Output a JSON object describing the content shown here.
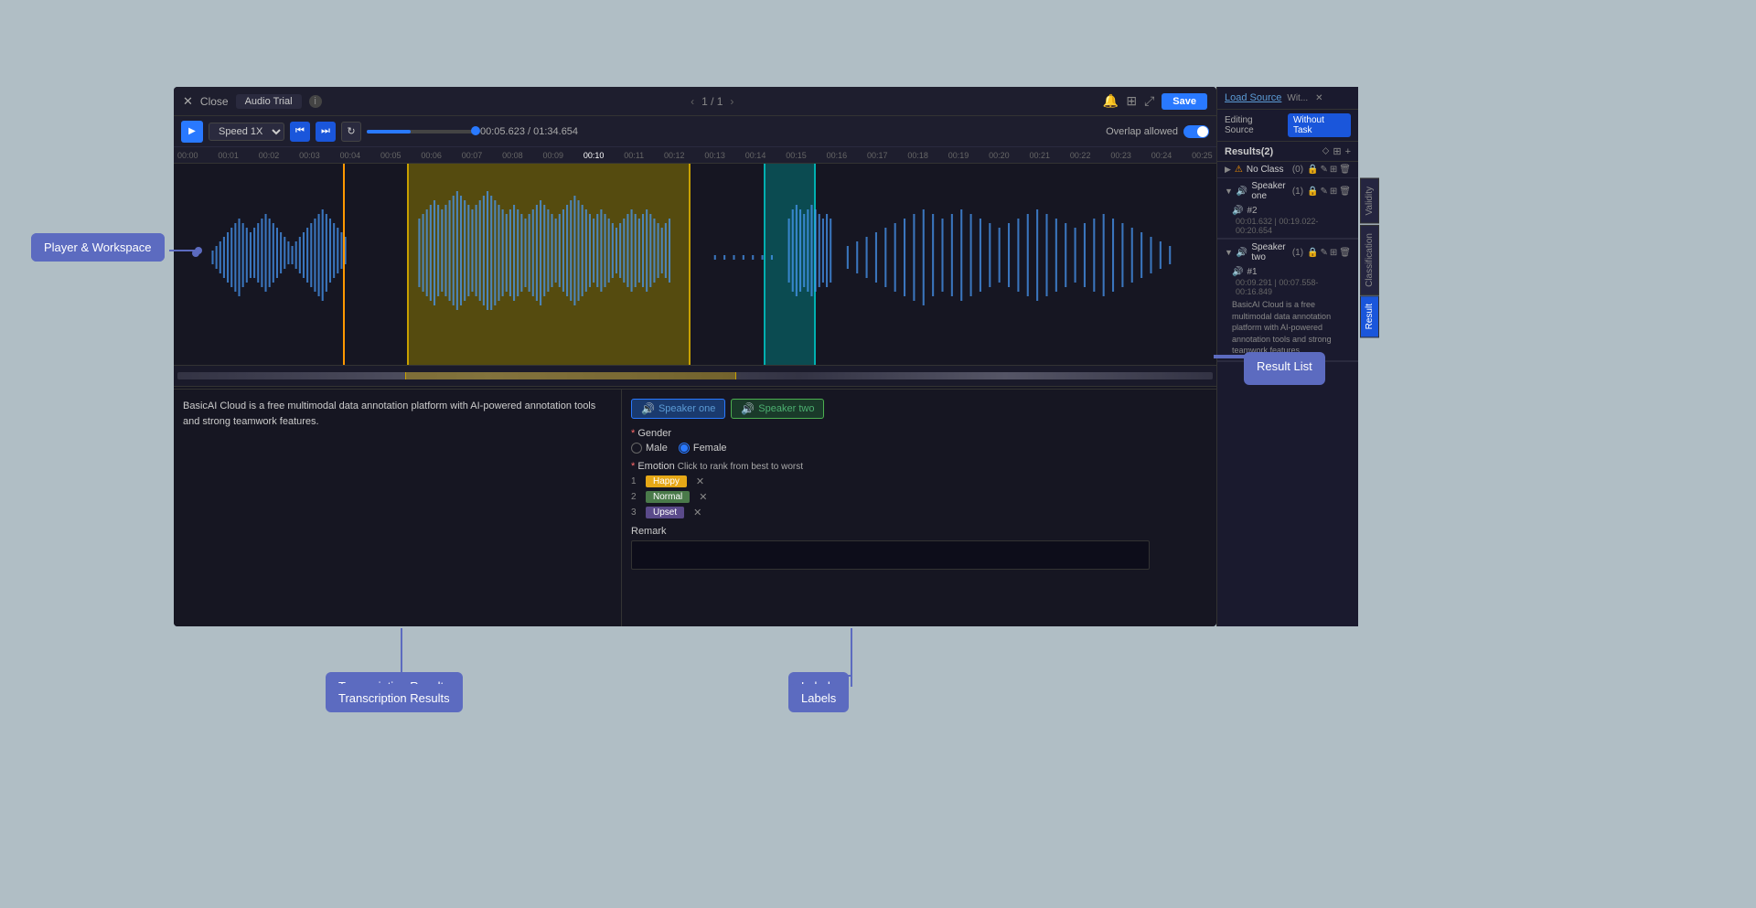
{
  "app": {
    "title": "Audio Trial",
    "close_label": "Close",
    "save_label": "Save",
    "page_nav": "1 / 1"
  },
  "toolbar": {
    "speed_label": "Speed 1X",
    "time_current": "00:05.623",
    "time_total": "01:34.654",
    "overlap_label": "Overlap allowed"
  },
  "ruler": {
    "marks": [
      "00:00",
      "00:01",
      "00:02",
      "00:03",
      "00:04",
      "00:05",
      "00:06",
      "00:07",
      "00:08",
      "00:09",
      "00:10",
      "00:11",
      "00:12",
      "00:13",
      "00:14",
      "00:15",
      "00:16",
      "00:17",
      "00:18",
      "00:19",
      "00:20",
      "00:21",
      "00:22",
      "00:23",
      "00:24",
      "00:25"
    ]
  },
  "sidebar": {
    "load_source_label": "Load Source",
    "load_source_short": "Wit...",
    "editing_source_label": "Editing Source",
    "without_task_label": "Without Task",
    "results_title": "Results(2)",
    "groups": [
      {
        "id": "no-class",
        "title": "No Class",
        "count": "(0)",
        "warning": true
      },
      {
        "id": "speaker-one",
        "title": "Speaker one",
        "count": "(1)",
        "items": [
          {
            "id": "#2",
            "time": "00:01.632 | 00:19.022-00:20.654"
          }
        ]
      },
      {
        "id": "speaker-two",
        "title": "Speaker two",
        "count": "(1)",
        "items": [
          {
            "id": "#1",
            "time": "00:09.291 | 00:07.558-00:16.849",
            "text": "BasicAI Cloud is a free multimodal data annotation platform with AI-powered annotation tools and strong teamwork features."
          }
        ]
      }
    ]
  },
  "transcription": {
    "text": "BasicAI Cloud is a free multimodal data annotation platform with AI-powered annotation tools and strong teamwork features."
  },
  "labels": {
    "speaker_one_label": "Speaker one",
    "speaker_two_label": "Speaker two",
    "gender_label": "Gender",
    "gender_required": "*",
    "male_label": "Male",
    "female_label": "Female",
    "emotion_label": "Emotion",
    "emotion_hint": "Click to rank from best to worst",
    "emotions": [
      {
        "rank": "1",
        "name": "Happy",
        "type": "happy"
      },
      {
        "rank": "2",
        "name": "Normal",
        "type": "normal"
      },
      {
        "rank": "3",
        "name": "Upset",
        "type": "upset"
      }
    ],
    "remark_label": "Remark"
  },
  "annotations": {
    "player_workspace_label": "Player & Workspace",
    "transcription_results_label": "Transcription Results",
    "labels_label": "Labels",
    "result_list_label": "Result List"
  },
  "vertical_tabs": [
    "Validity",
    "Classification",
    "Result"
  ]
}
